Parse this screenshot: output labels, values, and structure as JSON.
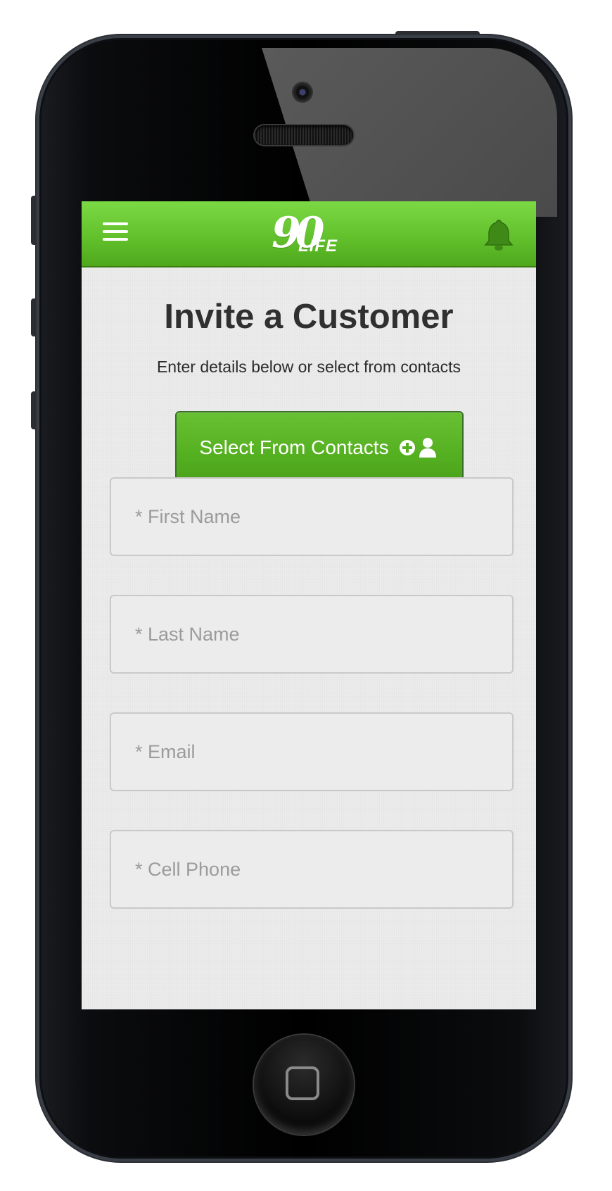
{
  "header": {
    "logo_number": "90",
    "logo_word": "LIFE",
    "menu_icon": "hamburger-menu-icon",
    "notification_icon": "bell-icon"
  },
  "page": {
    "title": "Invite a Customer",
    "subtitle": "Enter details below or select from contacts"
  },
  "contacts_button": {
    "label": "Select From Contacts",
    "icon": "add-contact-icon"
  },
  "form": {
    "first_name_placeholder": "* First Name",
    "last_name_placeholder": "* Last Name",
    "email_placeholder": "* Email",
    "cell_phone_placeholder": "* Cell Phone"
  },
  "colors": {
    "brand_green": "#5cb82a",
    "text_dark": "#303030",
    "placeholder_gray": "#9b9b9b"
  }
}
